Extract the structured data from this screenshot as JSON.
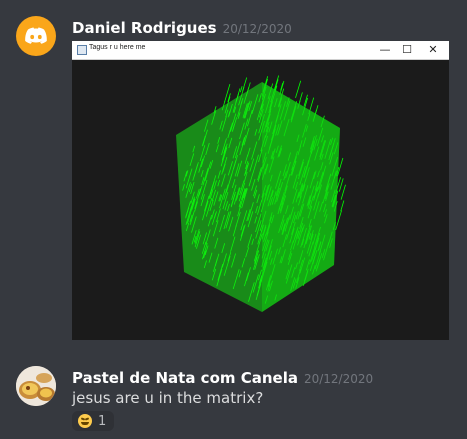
{
  "messages": [
    {
      "username": "Daniel Rodrigues",
      "timestamp": "20/12/2020",
      "avatar_icon": "discord-logo-icon",
      "avatar_color": "#faa61a",
      "attachment": {
        "window_title": "Tagus r u here me",
        "minimize": "—",
        "maximize": "☐",
        "close": "✕",
        "content_color": "#00ff00"
      }
    },
    {
      "username": "Pastel de Nata com Canela",
      "timestamp": "20/12/2020",
      "avatar_icon": "pastel-de-nata-avatar-icon",
      "text": "jesus are u in the matrix?",
      "reaction": {
        "emoji": "rolling-on-floor-laughing-icon",
        "count": "1"
      }
    }
  ]
}
